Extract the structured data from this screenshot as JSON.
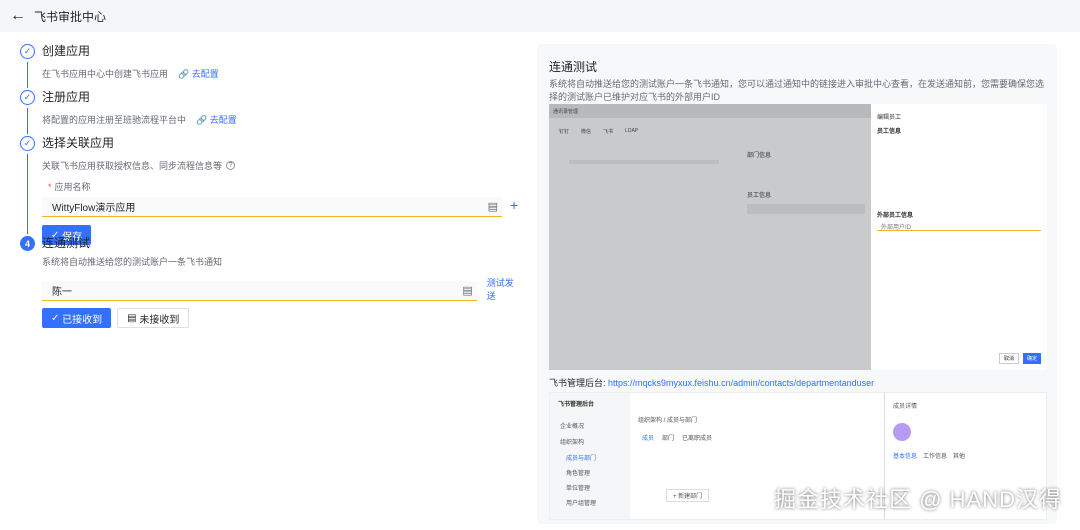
{
  "header": {
    "back_icon": "arrow-left-icon",
    "title": "飞书审批中心"
  },
  "steps": [
    {
      "title": "创建应用",
      "desc": "在飞书应用中心中创建飞书应用",
      "link": "去配置"
    },
    {
      "title": "注册应用",
      "desc": "将配置的应用注册至班驰流程平台中",
      "link": "去配置"
    },
    {
      "title": "选择关联应用",
      "desc": "关联飞书应用获取授权信息、同步流程信息等",
      "field_label": "应用名称",
      "field_value": "WittyFlow演示应用",
      "save_label": "保存"
    },
    {
      "number": "4",
      "title": "连通测试",
      "desc": "系统将自动推送给您的测试账户一条飞书通知",
      "field_value": "陈一",
      "test_link": "测试发送",
      "received_label": "已接收到",
      "not_received_label": "未接收到"
    }
  ],
  "right_panel": {
    "title": "连通测试",
    "description": "系统将自动推送给您的测试账户一条飞书通知，您可以通过通知中的链接进入审批中心查看，在发送通知前，您需要确保您选择的测试账户已维护对应飞书的外部用户ID",
    "admin_label": "飞书管理后台:",
    "admin_url": "https://mqcks9myxux.feishu.cn/admin/contacts/departmentanduser"
  },
  "screenshot1": {
    "header": "通讯录管理",
    "tabs": [
      "钉钉",
      "微信",
      "飞书",
      "LDAP"
    ],
    "drawer_title": "编辑员工",
    "drawer_section1": "员工信息",
    "drawer_section2": "外部员工信息",
    "drawer_section3": "外部用户ID",
    "dept_info": "部门信息",
    "emp_info": "员工信息",
    "cancel": "取消",
    "confirm": "确定"
  },
  "screenshot2": {
    "logo": "飞书管理后台",
    "side_items": [
      "企业概况",
      "组织架构",
      "成员与部门",
      "角色管理",
      "单位管理",
      "用户组管理"
    ],
    "tabs": [
      "成员",
      "部门",
      "已离职成员"
    ],
    "breadcrumb": "组织架构 / 成员与部门",
    "detail_title": "成员详情",
    "detail_tabs": [
      "基本信息",
      "工作信息",
      "其他"
    ],
    "add_dept": "+ 新建部门"
  },
  "watermark": "掘金技术社区 @ HAND汉得",
  "colors": {
    "accent": "#3370ff",
    "warning_border": "#f0b429"
  }
}
